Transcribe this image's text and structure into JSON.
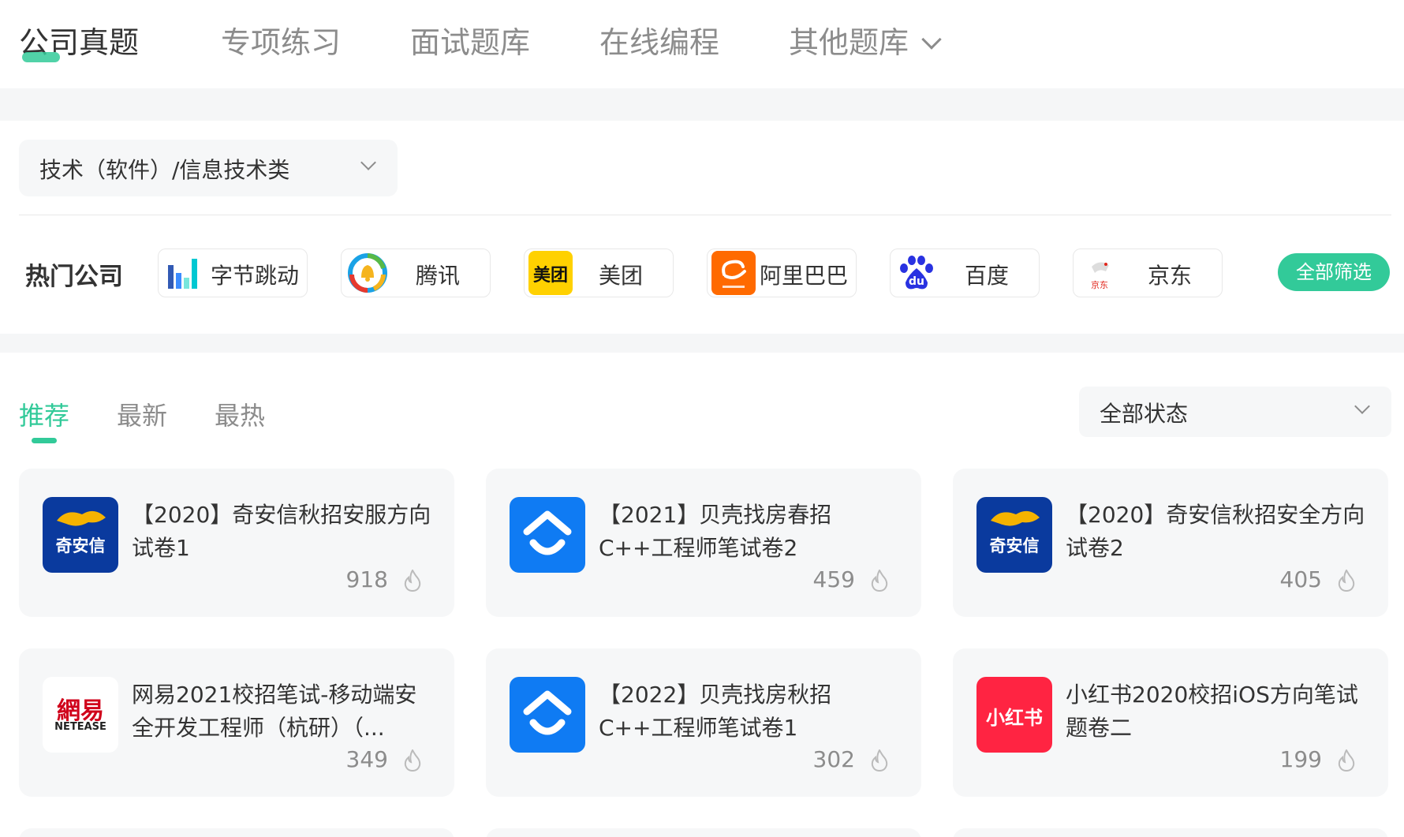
{
  "nav": {
    "tabs": [
      {
        "label": "公司真题"
      },
      {
        "label": "专项练习"
      },
      {
        "label": "面试题库"
      },
      {
        "label": "在线编程"
      },
      {
        "label": "其他题库"
      }
    ]
  },
  "category": {
    "value": "技术（软件）/信息技术类"
  },
  "hot": {
    "label": "热门公司",
    "companies": [
      {
        "name": "字节跳动",
        "logo": "bytedance-logo"
      },
      {
        "name": "腾讯",
        "logo": "tencent-logo"
      },
      {
        "name": "美团",
        "logo": "meituan-logo",
        "logo_text": "美团"
      },
      {
        "name": "阿里巴巴",
        "logo": "alibaba-logo"
      },
      {
        "name": "百度",
        "logo": "baidu-logo",
        "logo_text": "du"
      },
      {
        "name": "京东",
        "logo": "jd-logo",
        "logo_text": "京东"
      }
    ],
    "filter_label": "全部筛选"
  },
  "sort": {
    "tabs": [
      {
        "label": "推荐"
      },
      {
        "label": "最新"
      },
      {
        "label": "最热"
      }
    ]
  },
  "status": {
    "value": "全部状态"
  },
  "papers": [
    {
      "title": "【2020】奇安信秋招安服方向试卷1",
      "count": "918",
      "logo": "qianxin-logo",
      "logo_text": "奇安信"
    },
    {
      "title": "【2021】贝壳找房春招C++工程师笔试卷2",
      "count": "459",
      "logo": "beike-logo"
    },
    {
      "title": "【2020】奇安信秋招安全方向试卷2",
      "count": "405",
      "logo": "qianxin-logo",
      "logo_text": "奇安信"
    },
    {
      "title": "网易2021校招笔试-移动端安全开发工程师（杭研）（...",
      "count": "349",
      "logo": "netease-logo",
      "logo_text": "網易",
      "logo_sub": "NETEASE"
    },
    {
      "title": "【2022】贝壳找房秋招C++工程师笔试卷1",
      "count": "302",
      "logo": "beike-logo"
    },
    {
      "title": "小红书2020校招iOS方向笔试题卷二",
      "count": "199",
      "logo": "xiaohongshu-logo",
      "logo_text": "小红书"
    }
  ],
  "colors": {
    "accent": "#32ca99",
    "card_bg": "#f6f7f8",
    "muted": "#8c8c8c"
  }
}
